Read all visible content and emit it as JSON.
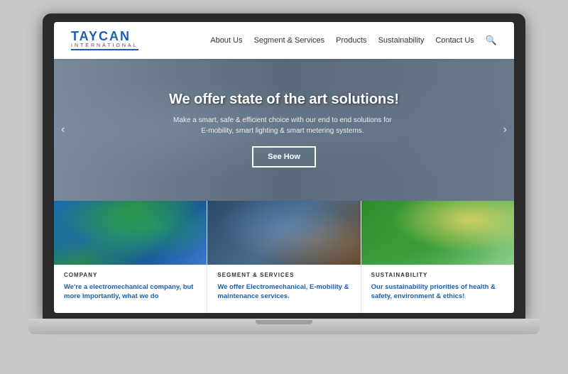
{
  "laptop": {
    "brand": "TAYCAN",
    "brand_sub": "INTERNATIONAL"
  },
  "nav": {
    "logo_text": "TAYCAN",
    "logo_sub": "INTERNATIONAL",
    "links": [
      {
        "label": "About Us"
      },
      {
        "label": "Segment & Services"
      },
      {
        "label": "Products"
      },
      {
        "label": "Sustainability"
      },
      {
        "label": "Contact Us"
      }
    ],
    "search_label": "Search"
  },
  "hero": {
    "title": "We offer state of the art solutions!",
    "subtitle": "Make a smart, safe & efficient choice with our end to end solutions for\nE-mobility, smart lighting & smart metering systems.",
    "cta_button": "See How",
    "arrow_left": "‹",
    "arrow_right": "›"
  },
  "cards": [
    {
      "category": "COMPANY",
      "description": "We're a electromechanical company, but more importantly, what we do",
      "img_type": "company"
    },
    {
      "category": "SEGMENT & SERVICES",
      "description": "We offer Electromechanical, E-mobility & maintenance services.",
      "img_type": "services"
    },
    {
      "category": "SUSTAINABILITY",
      "description": "Our sustainability priorities of health & safety, environment & ethics!",
      "img_type": "sustainability"
    }
  ]
}
